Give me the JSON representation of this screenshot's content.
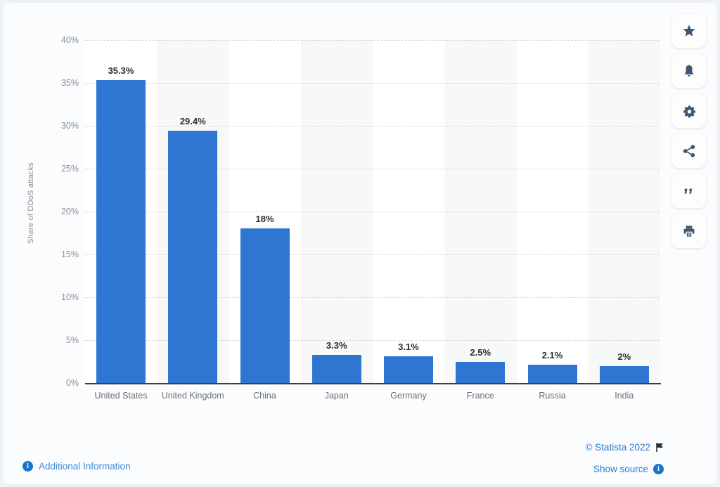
{
  "chart_data": {
    "type": "bar",
    "title": "",
    "subtitle": "",
    "xlabel": "",
    "ylabel": "Share of DDoS attacks",
    "ylim": [
      0,
      40
    ],
    "ytick_values": [
      0,
      5,
      10,
      15,
      20,
      25,
      30,
      35,
      40
    ],
    "ytick_labels": [
      "0%",
      "5%",
      "10%",
      "15%",
      "20%",
      "25%",
      "30%",
      "35%",
      "40%"
    ],
    "grid": true,
    "legend": "none",
    "bar_color": "#2e76d2",
    "categories": [
      "United States",
      "United Kingdom",
      "China",
      "Japan",
      "Germany",
      "France",
      "Russia",
      "India"
    ],
    "values": [
      35.3,
      29.4,
      18,
      3.3,
      3.1,
      2.5,
      2.1,
      2
    ],
    "data_labels": [
      "35.3%",
      "29.4%",
      "18%",
      "3.3%",
      "3.1%",
      "2.5%",
      "2.1%",
      "2%"
    ]
  },
  "footer": {
    "additional_information": "Additional Information",
    "copyright": "© Statista 2022",
    "show_source": "Show source"
  },
  "rail": {
    "items": [
      {
        "name": "favorite",
        "icon": "star-icon"
      },
      {
        "name": "alerts",
        "icon": "bell-icon"
      },
      {
        "name": "settings",
        "icon": "gear-icon"
      },
      {
        "name": "share",
        "icon": "share-icon"
      },
      {
        "name": "cite",
        "icon": "quote-icon"
      },
      {
        "name": "print",
        "icon": "printer-icon"
      }
    ]
  },
  "colors": {
    "bar": "#2e76d2",
    "link": "#2979cf",
    "axis": "#3c4043",
    "tick_text": "#8a8f95",
    "page_bg": "#eef1f6",
    "card_bg": "#fbfcfd"
  }
}
